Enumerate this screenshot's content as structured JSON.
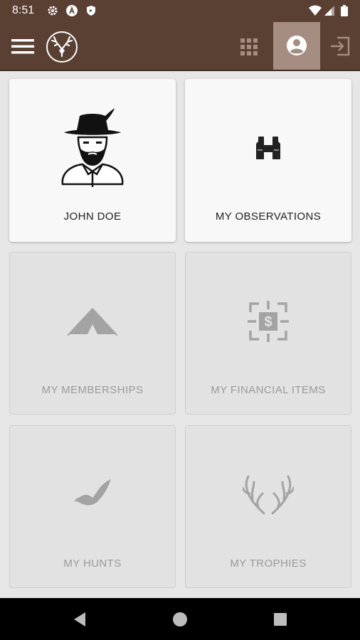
{
  "status_bar": {
    "time": "8:51",
    "icons": [
      "settings-icon",
      "a-icon",
      "shield-icon",
      "wifi-icon",
      "signal-icon",
      "battery-icon"
    ]
  },
  "app_bar": {
    "menu_icon": "hamburger-menu-icon",
    "logo_icon": "deer-antler-logo-icon",
    "grid_icon": "apps-grid-icon",
    "profile_icon": "account-circle-icon",
    "logout_icon": "logout-icon",
    "color": "#5a3f33",
    "active_tab_color": "#a58d82"
  },
  "tiles": [
    {
      "label": "JOHN DOE",
      "icon": "hunter-avatar-icon",
      "enabled": true
    },
    {
      "label": "MY OBSERVATIONS",
      "icon": "binoculars-icon",
      "enabled": true
    },
    {
      "label": "MY MEMBERSHIPS",
      "icon": "tent-icon",
      "enabled": false
    },
    {
      "label": "MY FINANCIAL ITEMS",
      "icon": "dollar-target-icon",
      "enabled": false
    },
    {
      "label": "MY HUNTS",
      "icon": "duck-icon",
      "enabled": false
    },
    {
      "label": "MY TROPHIES",
      "icon": "antlers-icon",
      "enabled": false
    }
  ],
  "nav_bar": {
    "buttons": [
      "back-icon",
      "home-icon",
      "recents-icon"
    ]
  }
}
